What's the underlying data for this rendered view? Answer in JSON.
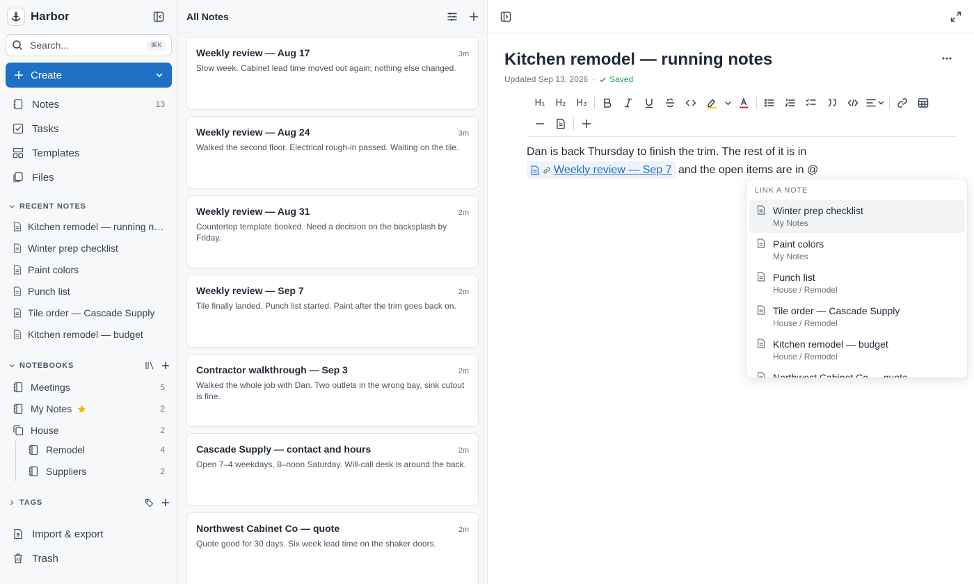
{
  "sidebar": {
    "app_name": "Harbor",
    "search_placeholder": "Search...",
    "search_shortcut": "⌘K",
    "create_label": "Create",
    "nav": [
      {
        "label": "Notes",
        "count": "13"
      },
      {
        "label": "Tasks"
      },
      {
        "label": "Templates"
      },
      {
        "label": "Files"
      }
    ],
    "recent_heading": "RECENT NOTES",
    "recent": [
      "Kitchen remodel — running notes",
      "Winter prep checklist",
      "Paint colors",
      "Punch list",
      "Tile order — Cascade Supply",
      "Kitchen remodel — budget"
    ],
    "notebooks_heading": "NOTEBOOKS",
    "notebooks": [
      {
        "label": "Meetings",
        "count": "5"
      },
      {
        "label": "My Notes",
        "count": "2",
        "starred": true
      },
      {
        "label": "House",
        "count": "2"
      },
      {
        "label": "Remodel",
        "count": "4",
        "child": true
      },
      {
        "label": "Suppliers",
        "count": "2",
        "child": true
      }
    ],
    "tags_heading": "TAGS",
    "footer": [
      {
        "label": "Import & export"
      },
      {
        "label": "Trash"
      }
    ],
    "star_color": "#f5b301"
  },
  "list": {
    "title": "All Notes",
    "notes": [
      {
        "title": "Weekly review — Aug 17",
        "time": "3m",
        "preview": "Slow week. Cabinet lead time moved out again; nothing else changed."
      },
      {
        "title": "Weekly review — Aug 24",
        "time": "3m",
        "preview": "Walked the second floor. Electrical rough-in passed. Waiting on the tile."
      },
      {
        "title": "Weekly review — Aug 31",
        "time": "2m",
        "preview": "Countertop template booked. Need a decision on the backsplash by Friday."
      },
      {
        "title": "Weekly review — Sep 7",
        "time": "2m",
        "preview": "Tile finally landed. Punch list started. Paint after the trim goes back on."
      },
      {
        "title": "Contractor walkthrough — Sep 3",
        "time": "2m",
        "preview": "Walked the whole job with Dan. Two outlets in the wrong bay, sink cutout is fine."
      },
      {
        "title": "Cascade Supply — contact and hours",
        "time": "2m",
        "preview": "Open 7–4 weekdays, 8–noon Saturday. Will-call desk is around the back."
      },
      {
        "title": "Northwest Cabinet Co — quote",
        "time": "2m",
        "preview": "Quote good for 30 days. Six week lead time on the shaker doors."
      }
    ]
  },
  "editor": {
    "title": "Kitchen remodel — running notes",
    "updated": "Updated Sep 13, 2026",
    "dot": "·",
    "saved": "Saved",
    "toolbar": {
      "h1": "H₁",
      "h2": "H₂",
      "h3": "H₃"
    },
    "body_line1": "Dan is back Thursday to finish the trim. The rest of it is in",
    "link_text": "Weekly review — Sep 7",
    "body_line2": " and the open items are in @",
    "popup": {
      "heading": "LINK A NOTE",
      "options": [
        {
          "title": "Winter prep checklist",
          "sub": "My Notes"
        },
        {
          "title": "Paint colors",
          "sub": "My Notes"
        },
        {
          "title": "Punch list",
          "sub": "House / Remodel"
        },
        {
          "title": "Tile order — Cascade Supply",
          "sub": "House / Remodel"
        },
        {
          "title": "Kitchen remodel — budget",
          "sub": "House / Remodel"
        },
        {
          "title": "Northwest Cabinet Co — quote",
          "sub": ""
        }
      ]
    },
    "accent": "#1f6fc5",
    "saved_color": "#16a34a"
  }
}
